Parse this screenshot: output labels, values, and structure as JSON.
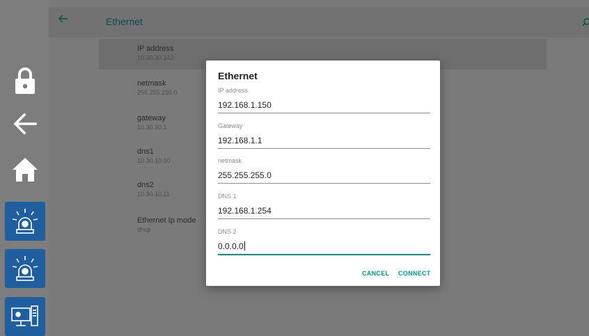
{
  "header": {
    "title": "Ethernet"
  },
  "colors": {
    "accent": "#009688",
    "sidebar_blue": "#1f5fa0",
    "title_text": "#0b4d49"
  },
  "sidebar": {
    "icons": [
      "lock-icon",
      "back-arrow-icon",
      "home-icon",
      "alarm-light-icon",
      "alarm-light-icon",
      "computer-monitor-icon"
    ]
  },
  "settings_list": [
    {
      "label": "IP address",
      "value": "10.30.30.142"
    },
    {
      "label": "netmask",
      "value": "255.255.255.0"
    },
    {
      "label": "gateway",
      "value": "10.30.30.1"
    },
    {
      "label": "dns1",
      "value": "10.30.10.10"
    },
    {
      "label": "dns2",
      "value": "10.30.10.11"
    },
    {
      "label": "Ethernet Ip mode",
      "value": "dhcp"
    }
  ],
  "dialog": {
    "title": "Ethernet",
    "fields": [
      {
        "label": "IP address",
        "value": "192.168.1.150"
      },
      {
        "label": "Gateway",
        "value": "192.168.1.1"
      },
      {
        "label": "netmask",
        "value": "255.255.255.0"
      },
      {
        "label": "DNS 1",
        "value": "192.168.1.254"
      },
      {
        "label": "DNS 2",
        "value": "0.0.0.0"
      }
    ],
    "cancel_label": "CANCEL",
    "connect_label": "CONNECT"
  }
}
